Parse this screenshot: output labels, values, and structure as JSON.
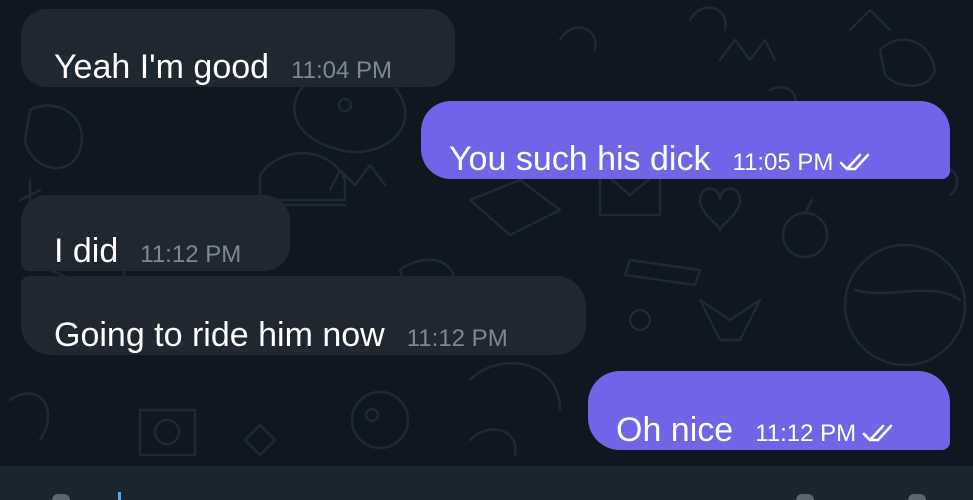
{
  "chat": {
    "messages": [
      {
        "direction": "incoming",
        "text": "Yeah I'm good",
        "time": "11:04 PM"
      },
      {
        "direction": "outgoing",
        "text": "You such his dick",
        "time": "11:05 PM",
        "status_icon": "double-check-icon"
      },
      {
        "direction": "incoming",
        "text": "I did",
        "time": "11:12 PM"
      },
      {
        "direction": "incoming",
        "text": "Going to ride him now",
        "time": "11:12 PM"
      },
      {
        "direction": "outgoing",
        "text": "Oh nice",
        "time": "11:12 PM",
        "status_icon": "double-check-icon"
      }
    ]
  },
  "colors": {
    "background": "#0f1720",
    "incoming_bubble": "#1f2830",
    "outgoing_bubble": "#7065e6",
    "incoming_time": "#7d8891",
    "composer": "#1b2530"
  }
}
